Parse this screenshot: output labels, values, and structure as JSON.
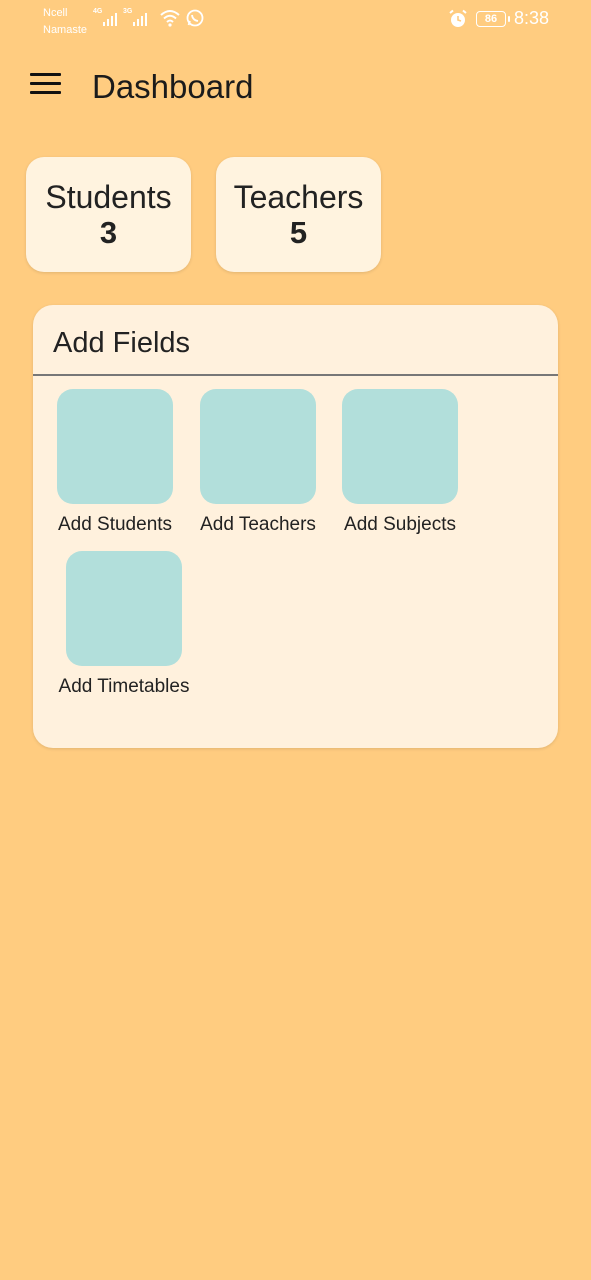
{
  "status_bar": {
    "carrier_line1": "Ncell",
    "carrier_line2": "Namaste",
    "signal1_tag": "4G",
    "signal2_tag": "3G",
    "battery": "86",
    "time": "8:38",
    "icons": [
      "signal-icon",
      "signal-icon",
      "wifi-icon",
      "whatsapp-icon",
      "alarm-icon",
      "battery-icon"
    ]
  },
  "app_bar": {
    "title": "Dashboard",
    "menu_icon": "hamburger-menu-icon"
  },
  "counts": [
    {
      "label": "Students",
      "value": "3"
    },
    {
      "label": "Teachers",
      "value": "5"
    }
  ],
  "add_fields": {
    "title": "Add Fields",
    "tiles": [
      {
        "label": "Add Students"
      },
      {
        "label": "Add Teachers"
      },
      {
        "label": "Add Subjects"
      },
      {
        "label": "Add Timetables"
      }
    ],
    "tile_color": "#B2DFDB"
  },
  "colors": {
    "background": "#FFCC80",
    "card": "#FFF3DF"
  }
}
